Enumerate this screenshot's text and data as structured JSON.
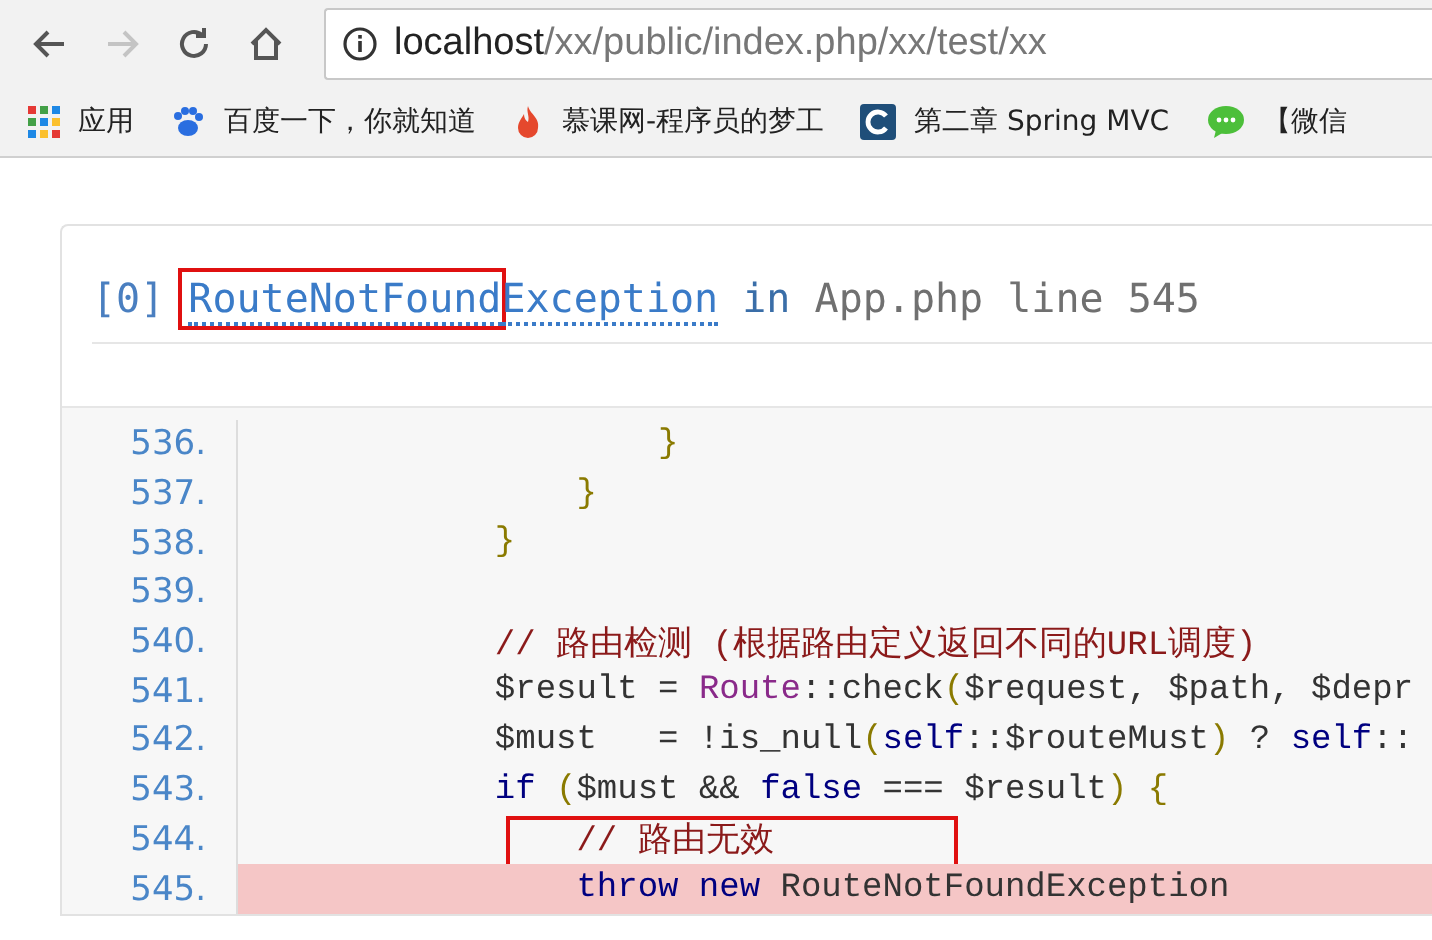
{
  "browser": {
    "address": {
      "host": "localhost",
      "path": "/xx/public/index.php/xx/test/xx"
    },
    "nav_buttons": [
      {
        "kind": "back",
        "disabled": false
      },
      {
        "kind": "forward",
        "disabled": true
      },
      {
        "kind": "reload",
        "disabled": false
      },
      {
        "kind": "home",
        "disabled": false
      }
    ],
    "bookmarks": [
      {
        "kind": "apps",
        "label": "应用"
      },
      {
        "kind": "paw",
        "label": "百度一下，你就知道"
      },
      {
        "kind": "flame",
        "label": "慕课网-程序员的梦工"
      },
      {
        "kind": "c-logo",
        "label": "第二章 Spring MVC"
      },
      {
        "kind": "chat",
        "label": "【微信"
      }
    ]
  },
  "error": {
    "title": [
      {
        "kind": "index",
        "text": "[0]",
        "boxed": false
      },
      {
        "kind": "link",
        "text": "RouteNotFound",
        "boxed": true
      },
      {
        "kind": "link",
        "text": "Exception",
        "boxed": false
      },
      {
        "kind": "keyword",
        "text": "in",
        "boxed": false
      },
      {
        "kind": "plain",
        "text": "App.php line 545",
        "boxed": false
      }
    ],
    "code": [
      {
        "number": "536.",
        "highlighted": false,
        "boxed": false,
        "tokens": [
          {
            "kind": "punct",
            "text": "                    }"
          }
        ]
      },
      {
        "number": "537.",
        "highlighted": false,
        "boxed": false,
        "tokens": [
          {
            "kind": "punct",
            "text": "                }"
          }
        ]
      },
      {
        "number": "538.",
        "highlighted": false,
        "boxed": false,
        "tokens": [
          {
            "kind": "punct",
            "text": "            }"
          }
        ]
      },
      {
        "number": "539.",
        "highlighted": false,
        "boxed": false
      },
      {
        "number": "540.",
        "highlighted": false,
        "boxed": false,
        "tokens": [
          {
            "kind": "comment",
            "text": "            // 路由检测 (根据路由定义返回不同的URL调度)"
          }
        ]
      },
      {
        "number": "541.",
        "highlighted": false,
        "boxed": false,
        "tokens": [
          {
            "kind": "plain",
            "text": "            $result = "
          },
          {
            "kind": "class",
            "text": "Route"
          },
          {
            "kind": "plain",
            "text": "::check"
          },
          {
            "kind": "punct",
            "text": "("
          },
          {
            "kind": "plain",
            "text": "$request, $path, $depr"
          }
        ]
      },
      {
        "number": "542.",
        "highlighted": false,
        "boxed": false,
        "tokens": [
          {
            "kind": "plain",
            "text": "            $must   = !is_null"
          },
          {
            "kind": "punct",
            "text": "("
          },
          {
            "kind": "keyword",
            "text": "self"
          },
          {
            "kind": "plain",
            "text": "::$routeMust"
          },
          {
            "kind": "punct",
            "text": ")"
          },
          {
            "kind": "plain",
            "text": " ? "
          },
          {
            "kind": "keyword",
            "text": "self"
          },
          {
            "kind": "plain",
            "text": "::"
          }
        ]
      },
      {
        "number": "543.",
        "highlighted": false,
        "boxed": false,
        "tokens": [
          {
            "kind": "keyword",
            "text": "            if"
          },
          {
            "kind": "punct",
            "text": " ("
          },
          {
            "kind": "plain",
            "text": "$must && "
          },
          {
            "kind": "keyword",
            "text": "false"
          },
          {
            "kind": "plain",
            "text": " === $result"
          },
          {
            "kind": "punct",
            "text": ") {"
          }
        ]
      },
      {
        "number": "544.",
        "highlighted": false,
        "boxed": true,
        "tokens": [
          {
            "kind": "comment",
            "text": "                // 路由无效"
          }
        ]
      },
      {
        "number": "545.",
        "highlighted": true,
        "boxed": false,
        "tokens": [
          {
            "kind": "keyword",
            "text": "                throw new"
          },
          {
            "kind": "plain",
            "text": " RouteNotFoundException"
          }
        ]
      }
    ]
  }
}
